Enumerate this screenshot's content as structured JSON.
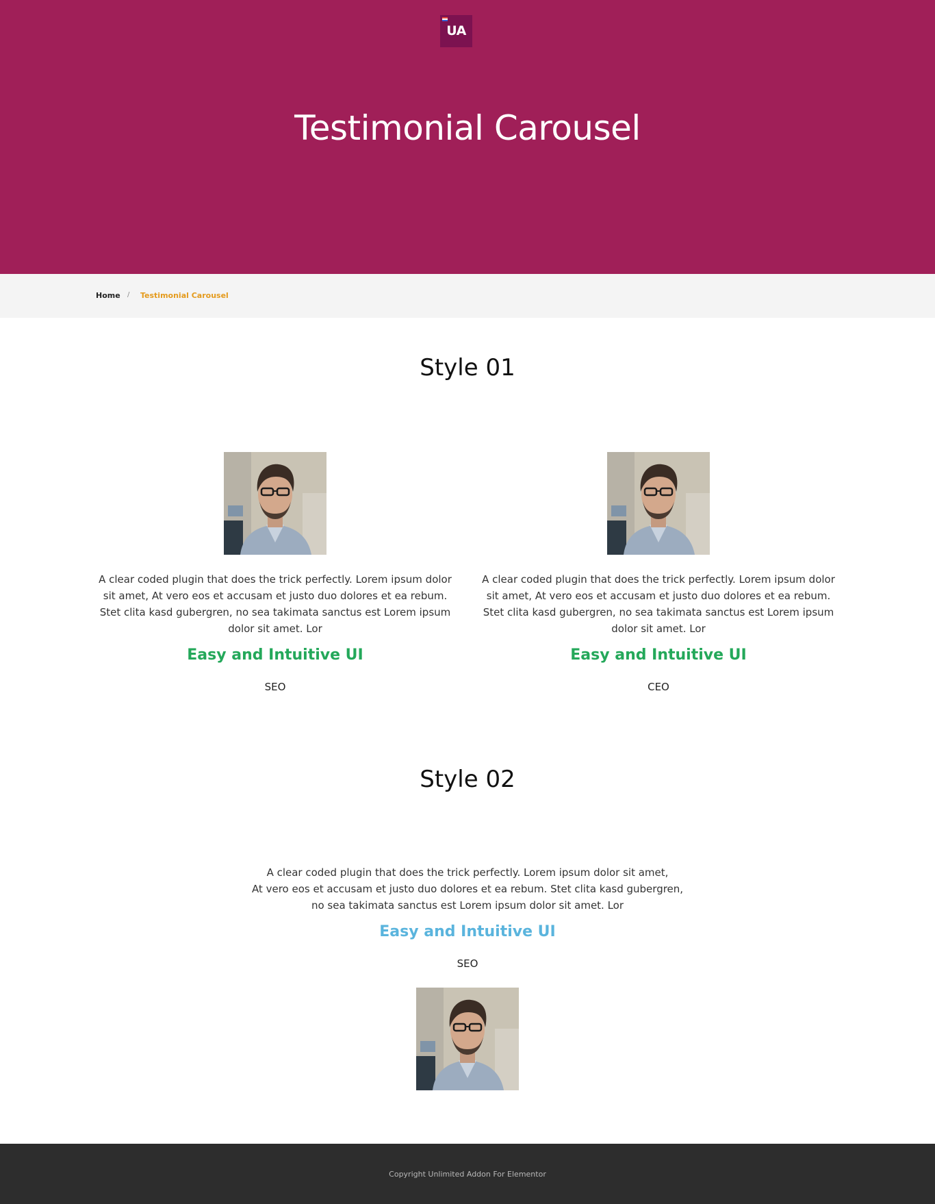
{
  "logo": {
    "text": "UA"
  },
  "hero": {
    "title": "Testimonial Carousel"
  },
  "breadcrumb": {
    "home": "Home",
    "separator": "/",
    "current": "Testimonial Carousel"
  },
  "style01": {
    "title": "Style 01",
    "testimonials": [
      {
        "quote": "A clear coded plugin that does the trick perfectly. Lorem ipsum dolor sit amet, At vero eos et accusam et justo duo dolores et ea rebum. Stet clita kasd gubergren, no sea takimata sanctus est Lorem ipsum dolor sit amet. Lor",
        "name": "Easy and Intuitive UI",
        "role": "SEO"
      },
      {
        "quote": "A clear coded plugin that does the trick perfectly. Lorem ipsum dolor sit amet, At vero eos et accusam et justo duo dolores et ea rebum. Stet clita kasd gubergren, no sea takimata sanctus est Lorem ipsum dolor sit amet. Lor",
        "name": "Easy and Intuitive UI",
        "role": "CEO"
      }
    ]
  },
  "style02": {
    "title": "Style 02",
    "testimonial": {
      "quote_lines": [
        "A clear coded plugin that does the trick perfectly. Lorem ipsum dolor sit amet,",
        "At vero eos et accusam et justo duo dolores et ea rebum. Stet clita kasd gubergren,",
        "no sea takimata sanctus est Lorem ipsum dolor sit amet. Lor"
      ],
      "name": "Easy and Intuitive UI",
      "role": "SEO"
    }
  },
  "footer": {
    "copyright": "Copyright Unlimited Addon For Elementor"
  },
  "colors": {
    "hero_bg": "#a01f58",
    "logo_bg": "#7c1250",
    "breadcrumb_active": "#e49a1c",
    "name_style01": "#24a85a",
    "name_style02": "#5ab4dd",
    "footer_bg": "#2d2d2d"
  }
}
